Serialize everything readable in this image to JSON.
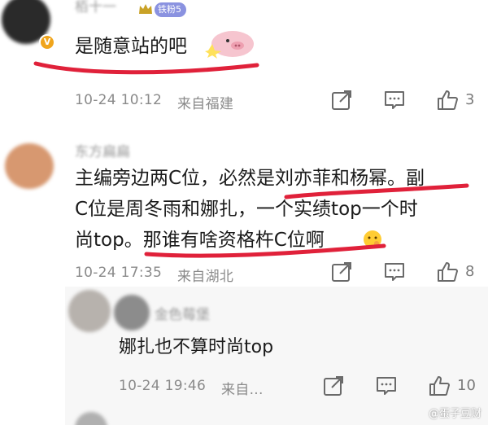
{
  "comments": [
    {
      "fan_badge": "铁粉5",
      "vip_icon": "v-icon",
      "text": "是随意站的吧",
      "time": "10-24 10:12",
      "location": "来自福建",
      "likes": "3"
    },
    {
      "text_line1": "主编旁边两C位，必然是刘亦菲和杨幂。副",
      "text_line2": "C位是周冬雨和娜扎，一个实绩top一个时",
      "text_line3": "尚top。那谁有啥资格杵C位啊",
      "time": "10-24 17:35",
      "location": "来自湖北",
      "likes": "8"
    }
  ],
  "reply": {
    "text": "娜扎也不算时尚top",
    "time": "10-24 19:46",
    "location": "来自...",
    "likes": "10"
  },
  "watermark": "@蛋子豆财",
  "colors": {
    "underline": "#e0213a",
    "meta": "#8a8a8a",
    "fan_badge": "#8a92e0"
  },
  "icons": [
    "share-icon",
    "comment-icon",
    "like-icon"
  ]
}
